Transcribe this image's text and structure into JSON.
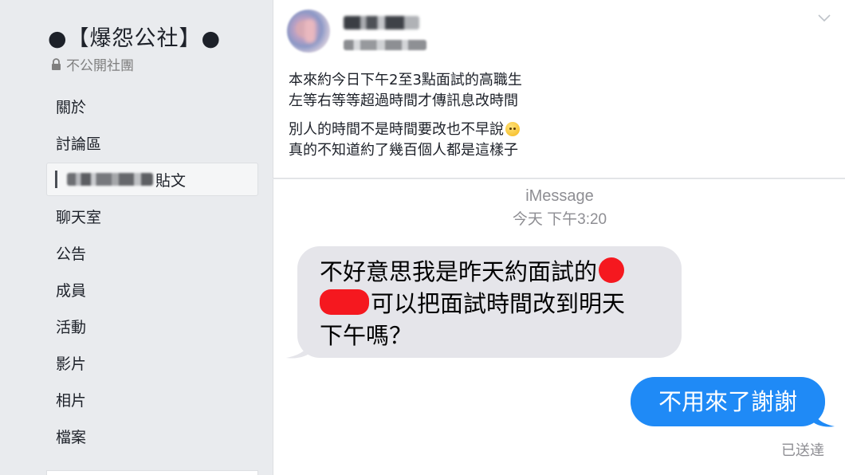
{
  "sidebar": {
    "group_title": "●【爆怨公社】●",
    "privacy": "不公開社團",
    "nav_items": [
      {
        "label": "關於"
      },
      {
        "label": "討論區"
      },
      {
        "label": "貼文",
        "active": true
      },
      {
        "label": "聊天室"
      },
      {
        "label": "公告"
      },
      {
        "label": "成員"
      },
      {
        "label": "活動"
      },
      {
        "label": "影片"
      },
      {
        "label": "相片"
      },
      {
        "label": "檔案"
      }
    ]
  },
  "post": {
    "lines_p1": [
      "本來約今日下午2至3點面試的高職生",
      "左等右等等超過時間才傳訊息改時間"
    ],
    "line_p2a": "別人的時間不是時間要改也不早說",
    "line_p2b": "真的不知道約了幾百個人都是這樣子"
  },
  "imessage": {
    "title": "iMessage",
    "time": "今天 下午3:20",
    "incoming": {
      "line1": "不好意思我是昨天約面試的",
      "line2": "可以把面試時間改到明天",
      "line3": "下午嗎？"
    },
    "outgoing": "不用來了謝謝",
    "status": "已送達"
  },
  "colors": {
    "sidebar_bg": "#e9ebee",
    "bubble_incoming": "#e5e5ea",
    "bubble_outgoing": "#1f8af6",
    "redaction": "#f5181f"
  }
}
